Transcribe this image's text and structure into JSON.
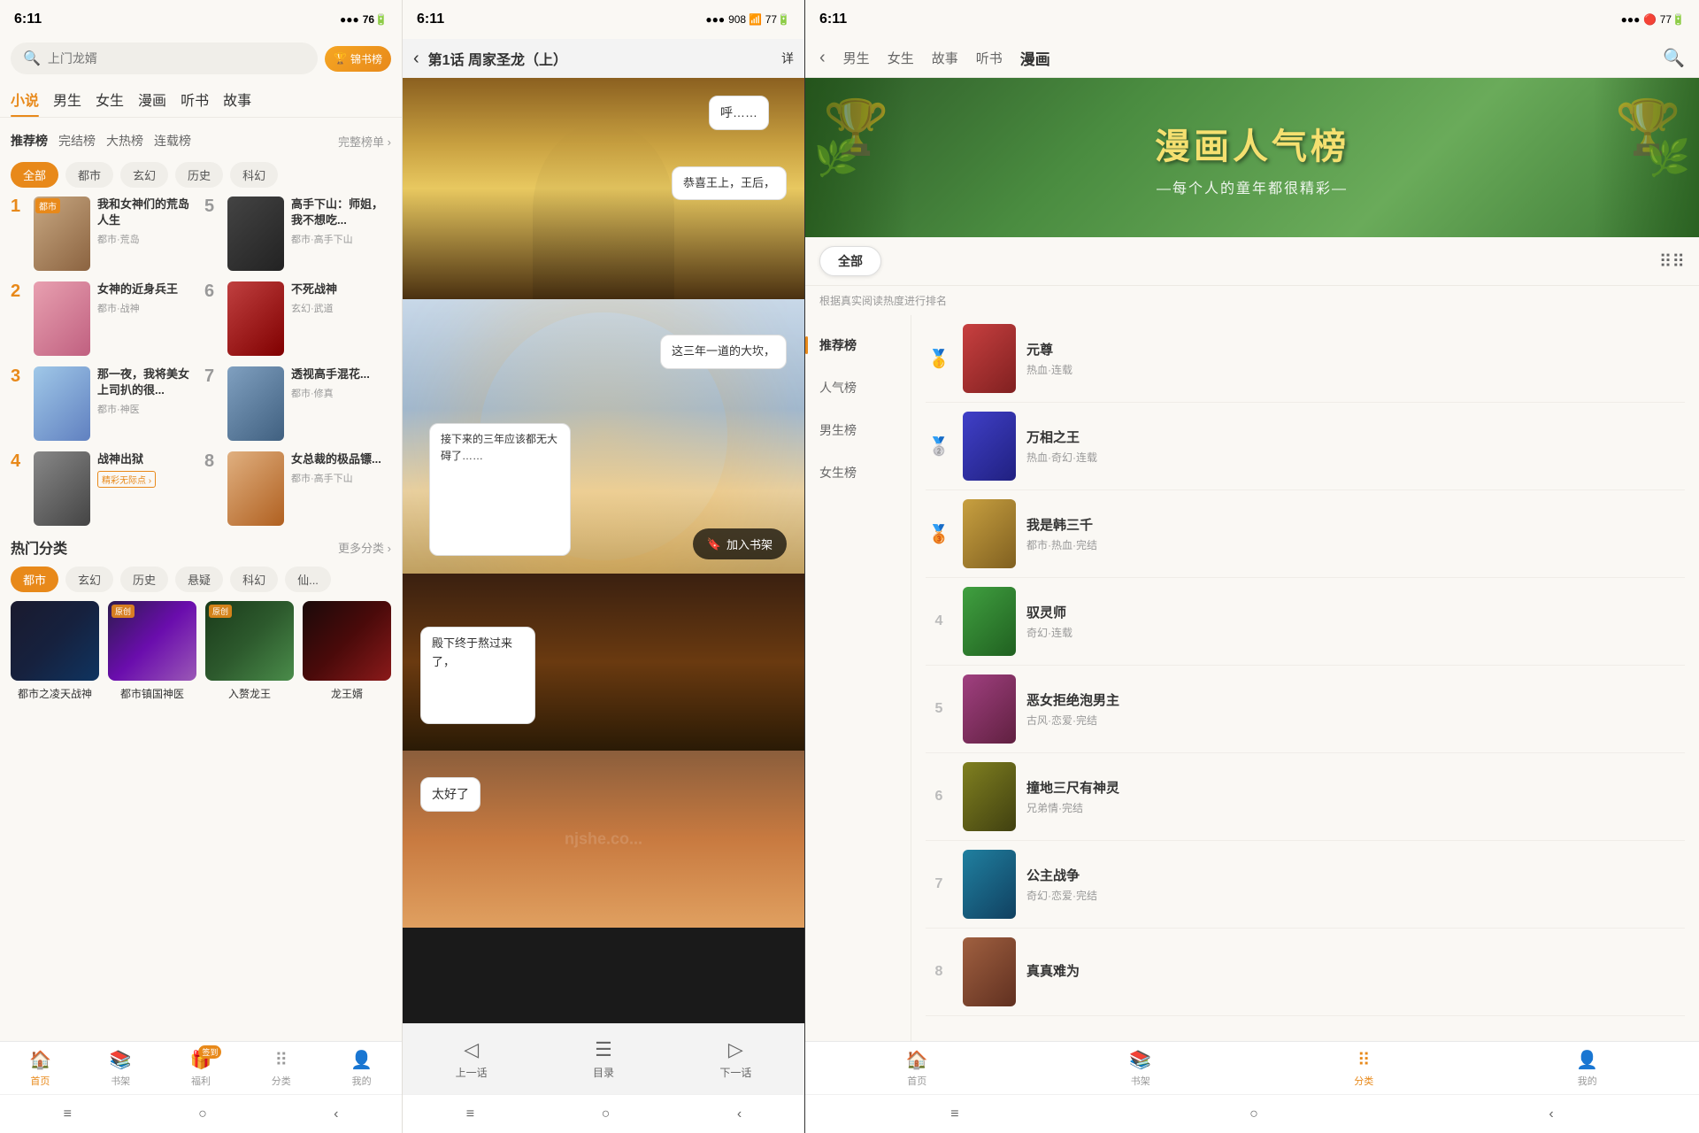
{
  "panel1": {
    "status": {
      "time": "6:11",
      "icons": "••• 139 ⊡ ▲ ◀ 76 ⚡"
    },
    "search": {
      "placeholder": "上门龙婿"
    },
    "jinbook": "锦书榜",
    "nav": {
      "items": [
        "小说",
        "男生",
        "女生",
        "漫画",
        "听书",
        "故事"
      ]
    },
    "ranking": {
      "tabs": [
        "推荐榜",
        "完结榜",
        "大热榜",
        "连载榜"
      ],
      "more": "完整榜单 ›",
      "filters": [
        "全部",
        "都市",
        "玄幻",
        "历史",
        "科幻"
      ]
    },
    "books": [
      {
        "rank": "1",
        "title": "我和女神们的荒岛人生",
        "tags": "都市·荒岛",
        "color": "cover-1",
        "badge": "都市"
      },
      {
        "rank": "5",
        "title": "高手下山：师姐，我不想吃...",
        "tags": "都市·高手下山",
        "color": "cover-5",
        "badge": ""
      },
      {
        "rank": "2",
        "title": "女神的近身兵王",
        "tags": "都市·战神",
        "color": "cover-2",
        "badge": ""
      },
      {
        "rank": "6",
        "title": "不死战神",
        "tags": "玄幻·武道",
        "color": "cover-6",
        "badge": ""
      },
      {
        "rank": "3",
        "title": "那一夜，我将美女上司扒的很...",
        "tags": "都市·神医",
        "color": "cover-3",
        "badge": ""
      },
      {
        "rank": "7",
        "title": "透视高手混花...",
        "tags": "都市·修真",
        "color": "cover-7",
        "badge": ""
      },
      {
        "rank": "4",
        "title": "战神出狱",
        "tags": "",
        "label": "精彩无际点 ›",
        "color": "cover-4",
        "badge": ""
      },
      {
        "rank": "8",
        "title": "女总裁的极品镖...",
        "tags": "都市·高手下山",
        "color": "cover-8",
        "badge": ""
      }
    ],
    "hot": {
      "title": "热门分类",
      "more": "更多分类 ›",
      "filters": [
        "都市",
        "玄幻",
        "历史",
        "悬疑",
        "科幻",
        "仙..."
      ],
      "books": [
        {
          "title": "都市之凌天战神",
          "color": "hc-1"
        },
        {
          "title": "都市镇国神医",
          "color": "hc-2",
          "badge": "原创"
        },
        {
          "title": "入赘龙王",
          "color": "hc-3",
          "badge": "原创"
        },
        {
          "title": "龙王婿",
          "color": "hc-4",
          "badge": ""
        }
      ]
    },
    "bottomNav": {
      "items": [
        "首页",
        "书架",
        "福利",
        "分类",
        "我的"
      ]
    }
  },
  "panel2": {
    "status": {
      "time": "6:11",
      "icons": "••• 908 ⊡ ▲ ◀ 77 ⚡"
    },
    "header": {
      "title": "第1话 周家圣龙（上）",
      "detail": "详"
    },
    "bubbles": [
      {
        "text": "呼……",
        "pos": "bubble-1"
      },
      {
        "text": "恭喜王上，王后，",
        "pos": "bubble-2"
      },
      {
        "text": "这三年一道的大坎，",
        "pos": "bubble-3"
      },
      {
        "text": "接下来的三年应该都无大碍了……",
        "pos": "bubble-4"
      },
      {
        "text": "殿下终于熬过来了，",
        "pos": "bubble-5"
      },
      {
        "text": "太好了",
        "pos": "bubble-6"
      }
    ],
    "addShelf": "加入书架",
    "footer": {
      "items": [
        "上一话",
        "目录",
        "下一话"
      ]
    },
    "watermark": "njshe.co..."
  },
  "panel3": {
    "status": {
      "time": "6:11",
      "icons": "••• ◉ ▲ ◀ 77 ⚡"
    },
    "nav": {
      "tabs": [
        "男生",
        "女生",
        "故事",
        "听书",
        "漫画"
      ]
    },
    "banner": {
      "main": "漫画人气榜",
      "sub": "—每个人的童年都很精彩—"
    },
    "filter": {
      "active": "全部"
    },
    "hint": "根据真实阅读热度进行排名",
    "sidebar": {
      "items": [
        "推荐榜",
        "人气榜",
        "男生榜",
        "女生榜"
      ]
    },
    "items": [
      {
        "rank": "1",
        "rankIcon": "🥇",
        "title": "元尊",
        "tags": "热血·连载",
        "color": "ic-1"
      },
      {
        "rank": "2",
        "rankIcon": "🥈",
        "title": "万相之王",
        "tags": "热血·奇幻·连载",
        "color": "ic-2"
      },
      {
        "rank": "3",
        "rankIcon": "🥉",
        "title": "我是韩三千",
        "tags": "都市·热血·完结",
        "color": "ic-3"
      },
      {
        "rank": "4",
        "rankIcon": "4",
        "title": "驭灵师",
        "tags": "奇幻·连载",
        "color": "ic-4"
      },
      {
        "rank": "5",
        "rankIcon": "5",
        "title": "恶女拒绝泡男主",
        "tags": "古风·恋爱·完结",
        "color": "ic-5"
      },
      {
        "rank": "6",
        "rankIcon": "6",
        "title": "撞地三尺有神灵",
        "tags": "兄弟情·完结",
        "color": "ic-6"
      },
      {
        "rank": "7",
        "rankIcon": "7",
        "title": "公主战争",
        "tags": "奇幻·恋爱·完结",
        "color": "ic-7"
      },
      {
        "rank": "8",
        "rankIcon": "8",
        "title": "真真难为",
        "tags": "",
        "color": "ic-8"
      }
    ],
    "bottomNav": {
      "items": [
        "≡",
        "□",
        "○",
        "‹"
      ]
    }
  }
}
